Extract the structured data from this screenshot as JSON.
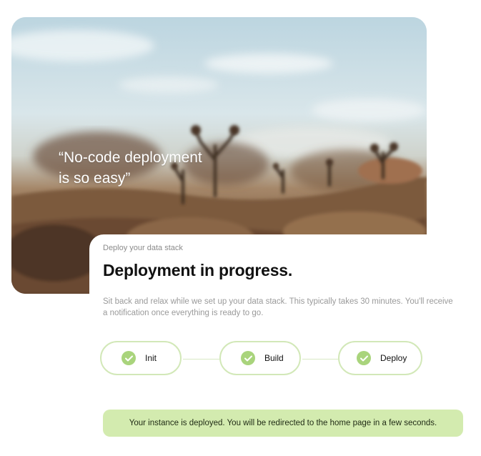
{
  "hero": {
    "quote_line1": "“No-code deployment",
    "quote_line2": "is so easy”",
    "image": "desert-landscape-photo"
  },
  "header": {
    "eyebrow": "Deploy your data stack",
    "title": "Deployment in progress.",
    "description": "Sit back and relax while we set up your data stack. This typically takes 30 minutes. You'll receive a notification once everything is ready to go."
  },
  "steps": [
    {
      "label": "Init",
      "status": "complete",
      "icon": "check-icon"
    },
    {
      "label": "Build",
      "status": "complete",
      "icon": "check-icon"
    },
    {
      "label": "Deploy",
      "status": "complete",
      "icon": "check-icon"
    }
  ],
  "banner": {
    "message": "Your instance is deployed. You will be redirected to the home page in a few seconds."
  },
  "colors": {
    "accent": "#a9d47c",
    "step_border": "#d2e8b8",
    "banner_bg": "#d3ebaf",
    "title_text": "#111111",
    "muted_text": "#9a9a9a"
  }
}
